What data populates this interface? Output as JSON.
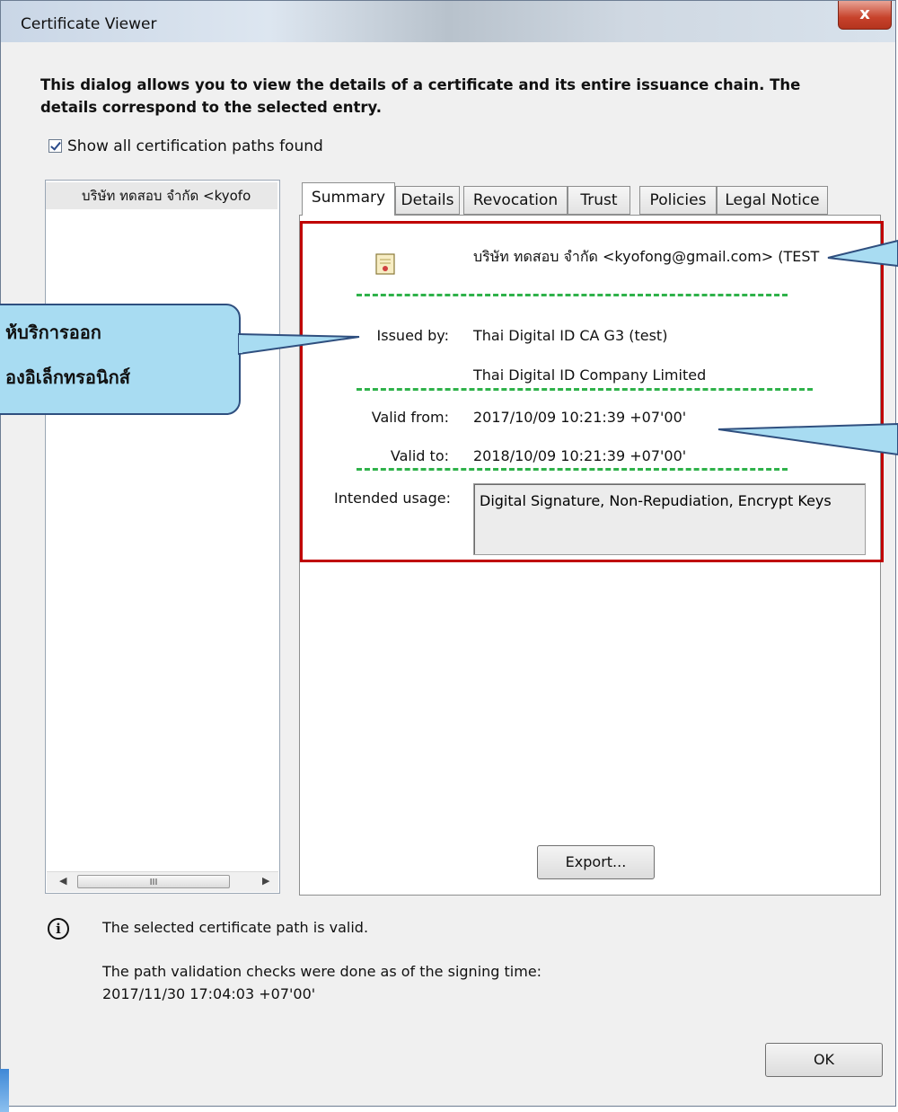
{
  "window": {
    "title": "Certificate Viewer",
    "close_label": "x"
  },
  "description": "This dialog allows you to view the details of a certificate and its entire issuance chain. The details correspond to the selected entry.",
  "show_all_paths": {
    "label": "Show all certification paths found",
    "checked": true
  },
  "tree": {
    "items": [
      {
        "label": "บริษัท ทดสอบ จำกัด <kyofo"
      }
    ],
    "scroll_thumb": "III"
  },
  "tabs": [
    {
      "label": "Summary",
      "active": true
    },
    {
      "label": "Details"
    },
    {
      "label": "Revocation"
    },
    {
      "label": "Trust"
    },
    {
      "label": "Policies"
    },
    {
      "label": "Legal Notice"
    }
  ],
  "summary": {
    "subject": "บริษัท ทดสอบ จำกัด <kyofong@gmail.com> (TEST",
    "issued_by_label": "Issued by:",
    "issued_by_line1": "Thai Digital ID CA G3 (test)",
    "issued_by_line2": "Thai Digital ID Company Limited",
    "valid_from_label": "Valid from:",
    "valid_from": "2017/10/09 10:21:39 +07'00'",
    "valid_to_label": "Valid to:",
    "valid_to": "2018/10/09 10:21:39 +07'00'",
    "usage_label": "Intended usage:",
    "usage": "Digital Signature, Non-Repudiation, Encrypt Keys"
  },
  "export_button": "Export...",
  "status": {
    "valid_text": "The selected certificate path is valid.",
    "check_text": "The path validation checks were done as of the signing time:",
    "check_time": "2017/11/30 17:04:03 +07'00'"
  },
  "ok_button": "OK",
  "callout": {
    "line1": "ห้บริการออก",
    "line2": "องอิเล็กทรอนิกส์"
  },
  "colors": {
    "highlight_border": "#c00000",
    "dash": "#2fb24a",
    "callout_fill": "#a8dcf2"
  }
}
